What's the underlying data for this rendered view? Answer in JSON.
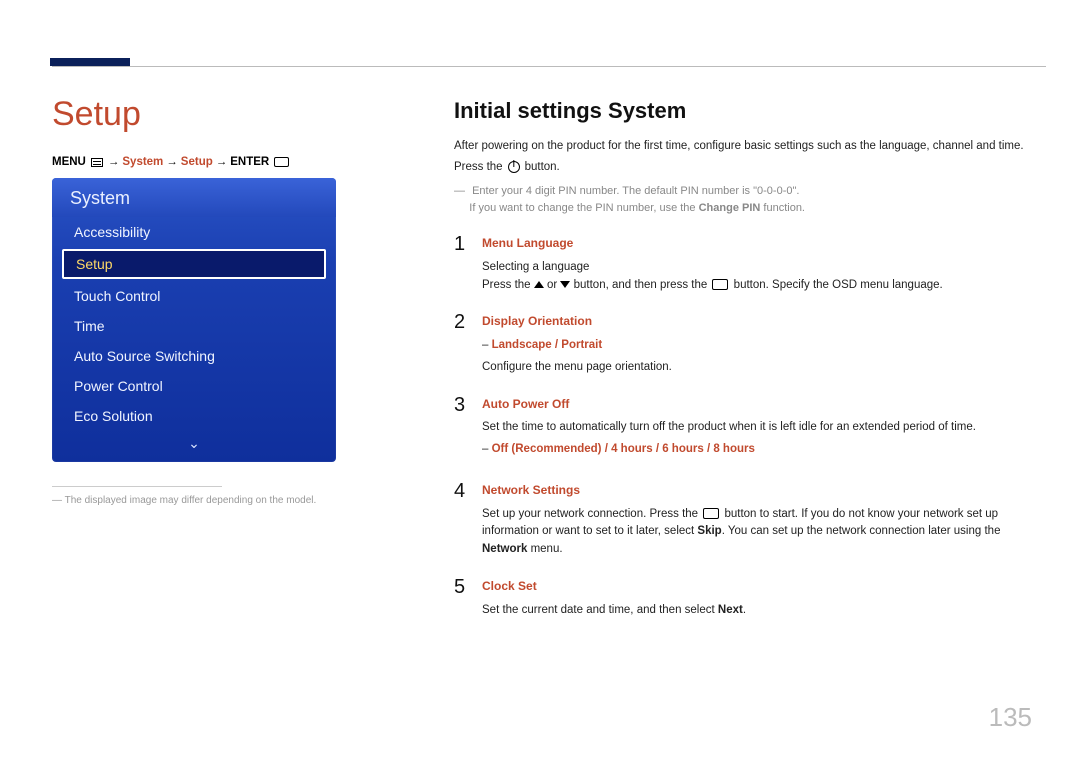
{
  "page_title": "Setup",
  "breadcrumb": {
    "prefix": "MENU",
    "seg1": "System",
    "seg2": "Setup",
    "suffix": "ENTER"
  },
  "menu": {
    "header": "System",
    "items": [
      {
        "label": "Accessibility",
        "selected": false
      },
      {
        "label": "Setup",
        "selected": true
      },
      {
        "label": "Touch Control",
        "selected": false
      },
      {
        "label": "Time",
        "selected": false
      },
      {
        "label": "Auto Source Switching",
        "selected": false
      },
      {
        "label": "Power Control",
        "selected": false
      },
      {
        "label": "Eco Solution",
        "selected": false
      }
    ]
  },
  "footnote_dash": "―",
  "footnote": "The displayed image may differ depending on the model.",
  "section_title": "Initial settings System",
  "intro": "After powering on the product for the first time, configure basic settings such as the language, channel and time.",
  "press_prefix": "Press the",
  "press_suffix": "button.",
  "pin_note_main": "Enter your 4 digit PIN number. The default PIN number is \"0-0-0-0\".",
  "pin_note_sub_a": "If you want to change the PIN number, use the",
  "pin_note_changepin": "Change PIN",
  "pin_note_sub_b": "function.",
  "steps": [
    {
      "num": "1",
      "label": "Menu Language",
      "lines": [
        "Selecting a language"
      ],
      "arrow_line": {
        "a": "Press the",
        "b": "or",
        "c": "button, and then press the",
        "d": "button. Specify the OSD menu language."
      }
    },
    {
      "num": "2",
      "label": "Display Orientation",
      "options": "Landscape / Portrait",
      "lines": [
        "Configure the menu page orientation."
      ]
    },
    {
      "num": "3",
      "label": "Auto Power Off",
      "lines": [
        "Set the time to automatically turn off the product when it is left idle for an extended period of time."
      ],
      "options": "Off (Recommended) / 4 hours / 6 hours / 8 hours"
    },
    {
      "num": "4",
      "label": "Network Settings",
      "net_line": {
        "a": "Set up your network connection. Press the",
        "b": "button to start. If you do not know your network set up information or want to set to it later, select",
        "skip": "Skip",
        "c": ". You can set up the network connection later using the",
        "net": "Network",
        "d": "menu."
      }
    },
    {
      "num": "5",
      "label": "Clock Set",
      "clock_line": {
        "a": "Set the current date and time, and then select",
        "next": "Next",
        "b": "."
      }
    }
  ],
  "page_number": "135"
}
